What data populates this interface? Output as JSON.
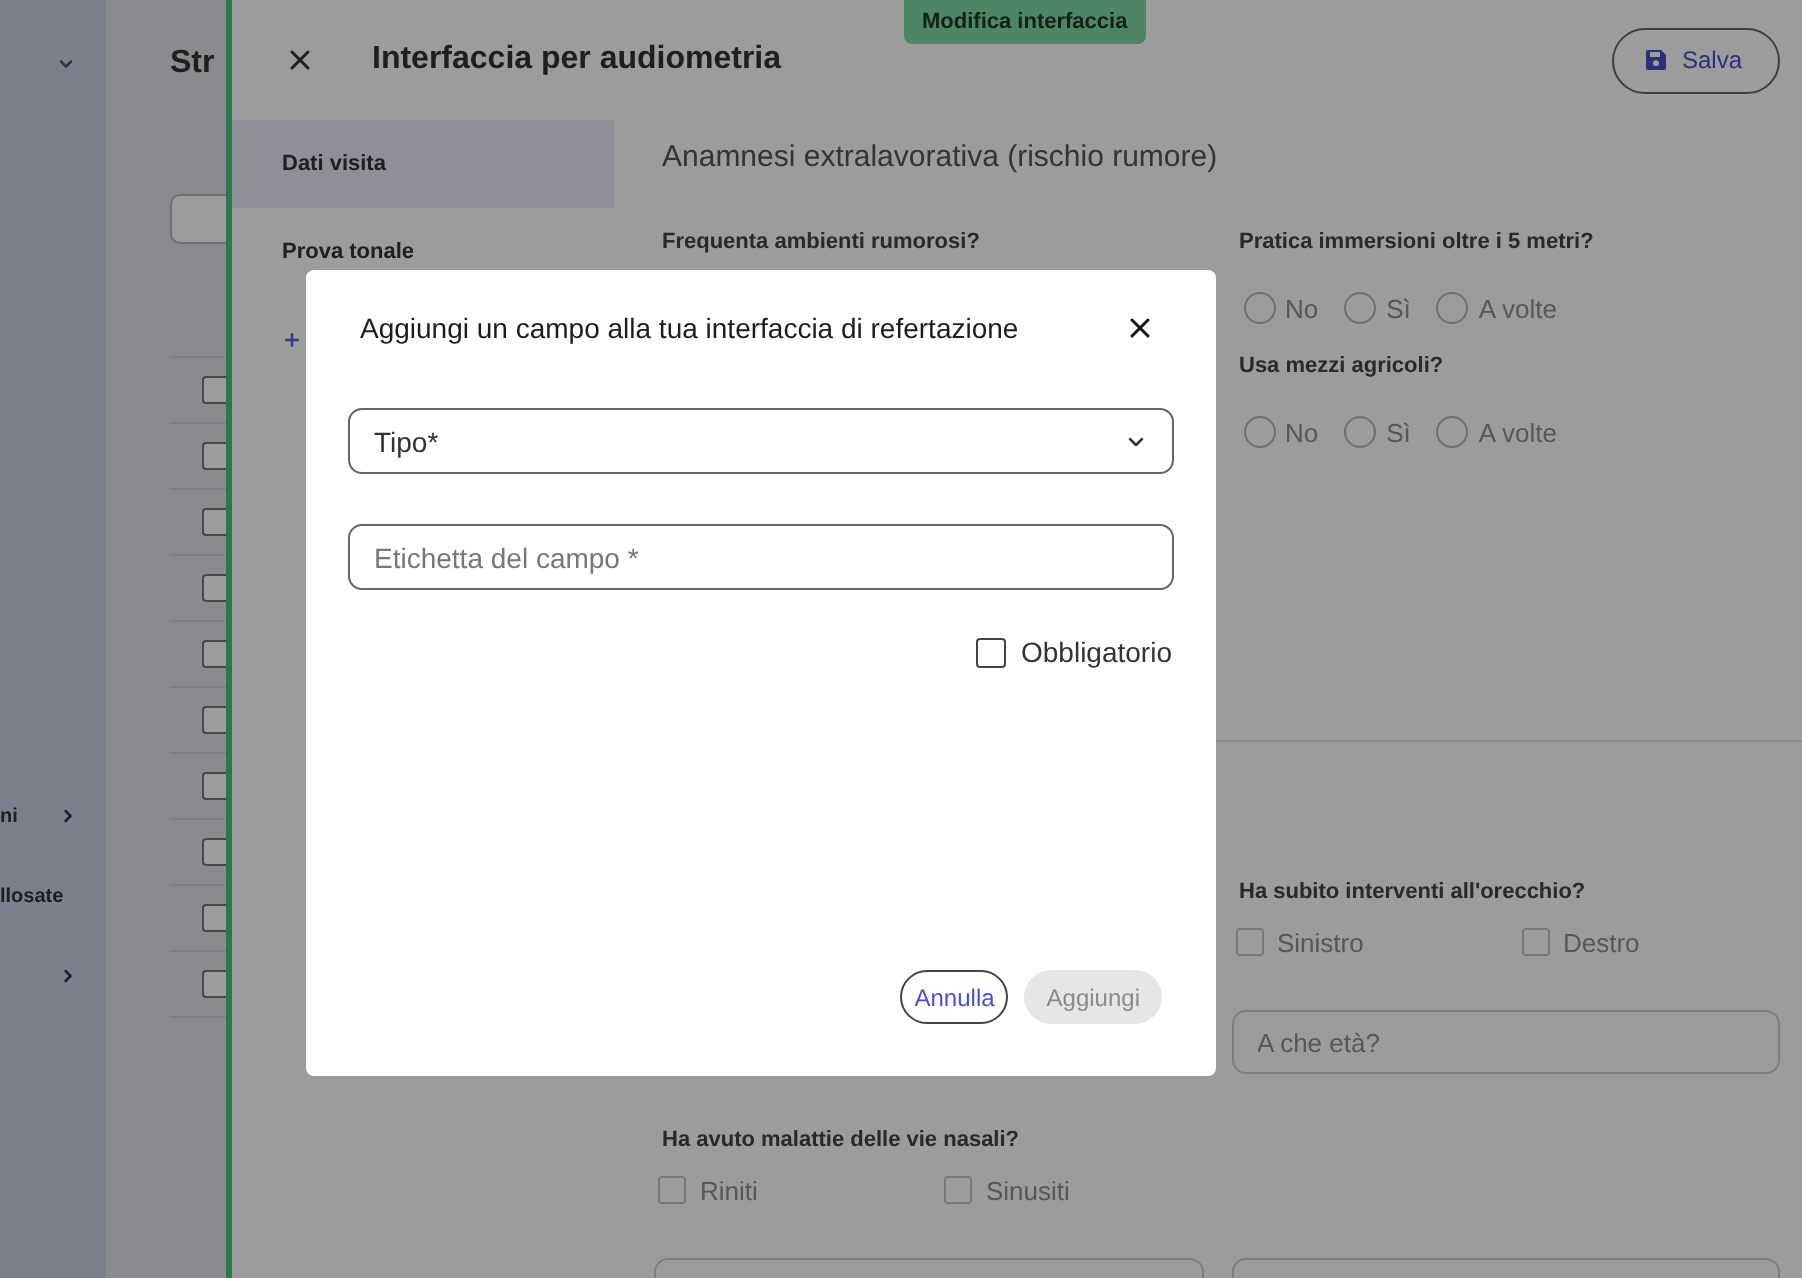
{
  "app_sidebar": {
    "items": [
      {
        "label": "ni",
        "has_arrow": true
      },
      {
        "label": "llosate",
        "has_arrow": false
      },
      {
        "has_arrow": true
      }
    ]
  },
  "list_pane": {
    "title": "Str",
    "rows": [
      {
        "checked": false
      },
      {
        "checked": false
      },
      {
        "checked": false
      },
      {
        "checked": false
      },
      {
        "checked": false
      },
      {
        "checked": false
      },
      {
        "checked": false
      },
      {
        "checked": false
      },
      {
        "checked": false
      },
      {
        "checked": false
      }
    ]
  },
  "editor": {
    "title": "Interfaccia per audiometria",
    "badge": "Modifica interfaccia",
    "save_button": "Salva",
    "tabs": [
      {
        "label": "Dati visita",
        "selected": true
      },
      {
        "label": "Prova tonale",
        "selected": false
      }
    ],
    "sections": [
      {
        "title": "Anamnesi extralavorativa (rischio rumore)",
        "rows": [
          {
            "left": [
              {
                "kind": "radio",
                "label": "Frequenta ambienti rumorosi?"
              }
            ],
            "right": [
              {
                "kind": "radio",
                "label": "Pratica immersioni oltre i 5 metri?",
                "options": [
                  {
                    "label": "No",
                    "selected": false
                  },
                  {
                    "label": "Sì",
                    "selected": false
                  },
                  {
                    "label": "A volte",
                    "selected": false
                  }
                ]
              },
              {
                "kind": "radio",
                "label": "Usa mezzi agricoli?",
                "options": [
                  {
                    "label": "No",
                    "selected": false
                  },
                  {
                    "label": "Sì",
                    "selected": false
                  },
                  {
                    "label": "A volte",
                    "selected": false
                  }
                ]
              }
            ]
          }
        ]
      },
      {
        "rows": [
          {
            "right": [
              {
                "kind": "checkbox",
                "label": "Ha subito interventi all'orecchio?",
                "options": [
                  {
                    "label": "Sinistro",
                    "checked": false
                  },
                  {
                    "label": "Destro",
                    "checked": false
                  }
                ]
              },
              {
                "kind": "text",
                "placeholder": "A che età?"
              }
            ]
          },
          {
            "left": [
              {
                "kind": "checkbox",
                "label": "Ha avuto malattie delle vie nasali?",
                "options": [
                  {
                    "label": "Riniti",
                    "checked": false
                  },
                  {
                    "label": "Sinusiti",
                    "checked": false
                  }
                ]
              },
              {
                "kind": "text"
              }
            ],
            "right": [
              {
                "kind": "text"
              }
            ]
          }
        ]
      }
    ]
  },
  "dialog": {
    "title": "Aggiungi un campo alla tua interfaccia di refertazione",
    "fields": [
      {
        "kind": "select",
        "label": "Tipo*"
      },
      {
        "kind": "text",
        "placeholder": "Etichetta del campo *"
      }
    ],
    "required": {
      "label": "Obbligatorio",
      "checked": false
    },
    "buttons": [
      {
        "label": "Annulla",
        "kind": "secondary",
        "disabled": false
      },
      {
        "label": "Aggiungi",
        "kind": "primary",
        "disabled": true
      }
    ]
  }
}
